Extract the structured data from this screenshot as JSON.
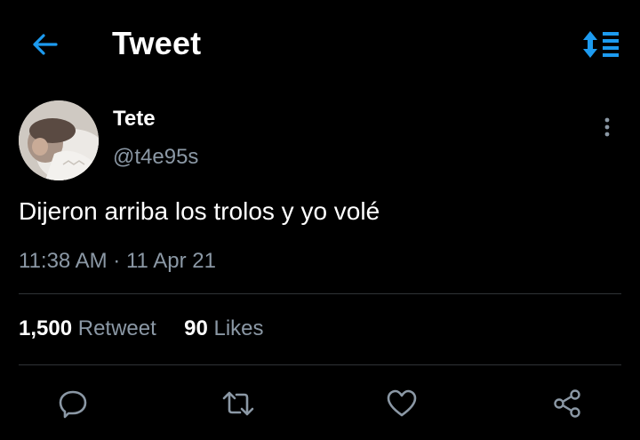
{
  "header": {
    "title": "Tweet",
    "back_icon": "arrow-left-icon",
    "sort_icon": "sort-arrows-icon",
    "accent_color": "#1d9bf0"
  },
  "tweet": {
    "author": {
      "display_name": "Tete",
      "handle": "@t4e95s",
      "avatar_icon": "avatar"
    },
    "text": "Dijeron arriba los trolos y yo volé",
    "time": "11:38 AM",
    "separator": " · ",
    "date": "11 Apr 21",
    "stats": {
      "retweets_count": "1,500",
      "retweets_label": "Retweet",
      "likes_count": "90",
      "likes_label": "Likes"
    },
    "actions": [
      {
        "icon": "reply-icon"
      },
      {
        "icon": "retweet-icon"
      },
      {
        "icon": "like-icon"
      },
      {
        "icon": "share-icon"
      }
    ]
  }
}
